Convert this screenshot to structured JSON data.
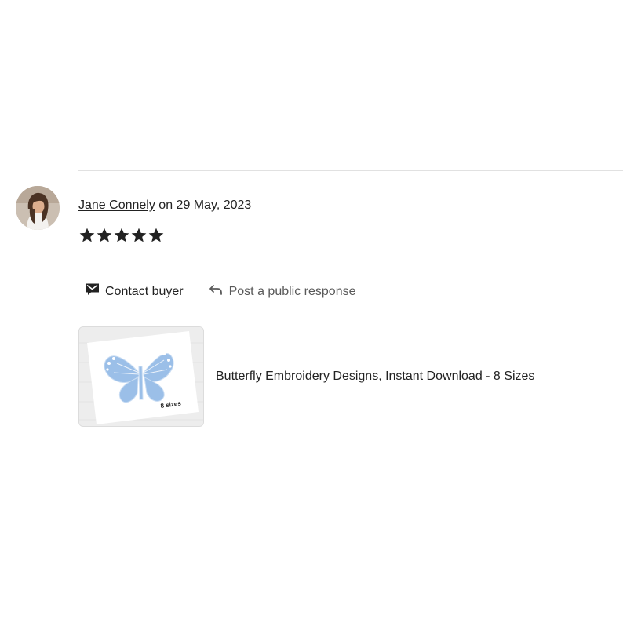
{
  "review": {
    "reviewer_name": "Jane Connely",
    "date_text": "on 29 May, 2023",
    "rating": 5,
    "max_rating": 5
  },
  "actions": {
    "contact_label": "Contact buyer",
    "contact_icon": "envelope-icon",
    "public_response_label": "Post a public response",
    "public_response_icon": "reply-arrow-icon"
  },
  "listing": {
    "title": "Butterfly Embroidery Designs, Instant Download - 8 Sizes",
    "thumbnail_text": "8 sizes",
    "butterfly_color": "#9bbfe8"
  },
  "colors": {
    "text": "#222222",
    "muted": "#595959",
    "divider": "#e1e1e1",
    "star": "#222222"
  }
}
